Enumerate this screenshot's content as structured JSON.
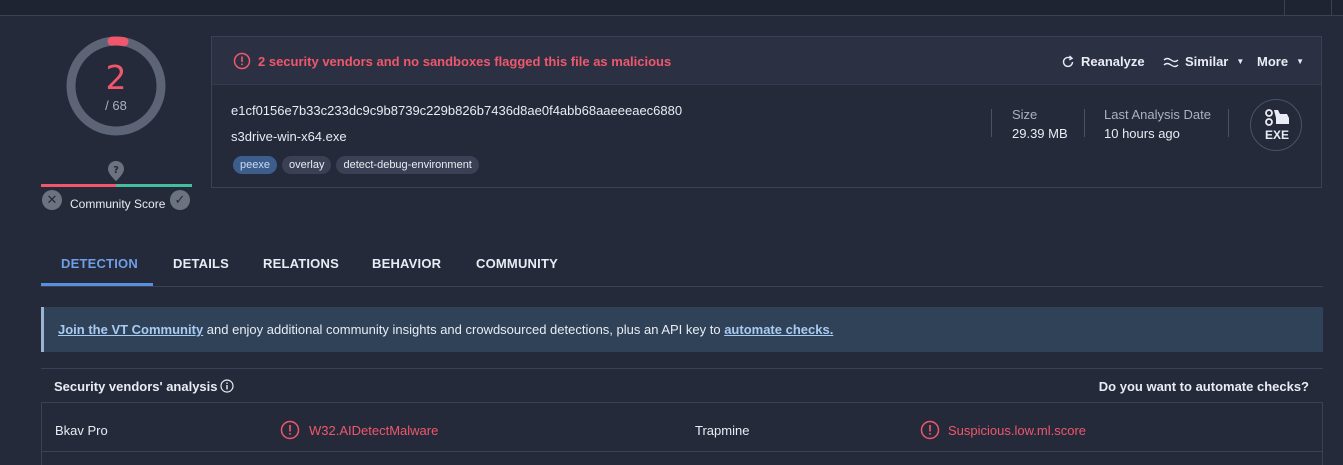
{
  "score": {
    "detections": "2",
    "total": "/ 68",
    "community_label": "Community Score"
  },
  "alert": {
    "text": "2 security vendors and no sandboxes flagged this file as malicious"
  },
  "actions": {
    "reanalyze": "Reanalyze",
    "similar": "Similar",
    "more": "More"
  },
  "file": {
    "hash": "e1cf0156e7b33c233dc9c9b8739c229b826b7436d8ae0f4abb68aaeeeaec6880",
    "name": "s3drive-win-x64.exe",
    "tags": [
      "peexe",
      "overlay",
      "detect-debug-environment"
    ],
    "size_label": "Size",
    "size_value": "29.39 MB",
    "date_label": "Last Analysis Date",
    "date_value": "10 hours ago",
    "type_badge": "EXE"
  },
  "tabs": [
    "DETECTION",
    "DETAILS",
    "RELATIONS",
    "BEHAVIOR",
    "COMMUNITY"
  ],
  "banner": {
    "link1": "Join the VT Community",
    "middle": " and enjoy additional community insights and crowdsourced detections, plus an API key to ",
    "link2": "automate checks."
  },
  "vendors": {
    "title": "Security vendors' analysis",
    "automate": "Do you want to automate checks?",
    "rows": [
      {
        "vendor1": "Bkav Pro",
        "result1": "W32.AIDetectMalware",
        "vendor2": "Trapmine",
        "result2": "Suspicious.low.ml.score"
      }
    ]
  },
  "colors": {
    "accent_red": "#f0576c",
    "accent_blue": "#6f9de6",
    "accent_green": "#46bd9c"
  }
}
